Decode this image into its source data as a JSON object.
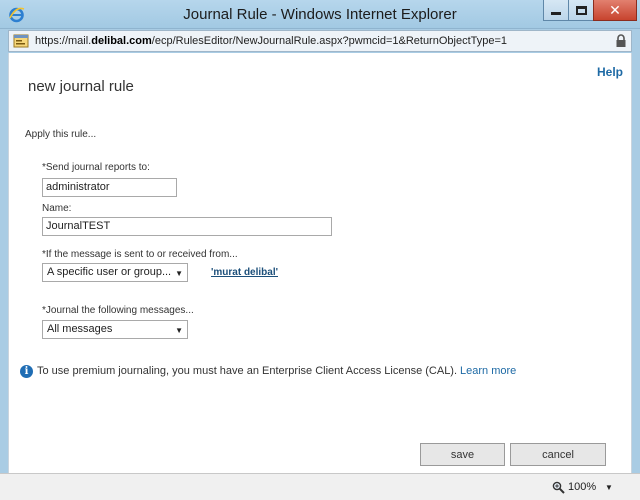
{
  "window": {
    "title": "Journal Rule - Windows Internet Explorer",
    "close_glyph": "✕"
  },
  "address": {
    "scheme": "https://mail.",
    "domain": "delibal.com",
    "path": "/ecp/RulesEditor/NewJournalRule.aspx?pwmcid=1&ReturnObjectType=1"
  },
  "page": {
    "help": "Help",
    "title": "new journal rule",
    "apply": "Apply this rule..."
  },
  "form": {
    "send_reports_label": "*Send journal reports to:",
    "send_reports_value": "administrator",
    "name_label": "Name:",
    "name_value": "JournalTEST",
    "condition_label": "*If the message is sent to or received from...",
    "condition_value": "A specific user or group...",
    "recipient_link": "'murat delibal'",
    "journal_label": "*Journal the following messages...",
    "journal_value": "All messages"
  },
  "info": {
    "icon_glyph": "i",
    "text": "To use premium journaling, you must have an Enterprise Client Access License (CAL).",
    "learn_more": "Learn more"
  },
  "buttons": {
    "save": "save",
    "cancel": "cancel"
  },
  "status": {
    "zoom": "100%",
    "dropdown_arrow": "▼"
  },
  "colors": {
    "accent_link": "#1e6aa5",
    "title_bar": "#a9cce4"
  }
}
